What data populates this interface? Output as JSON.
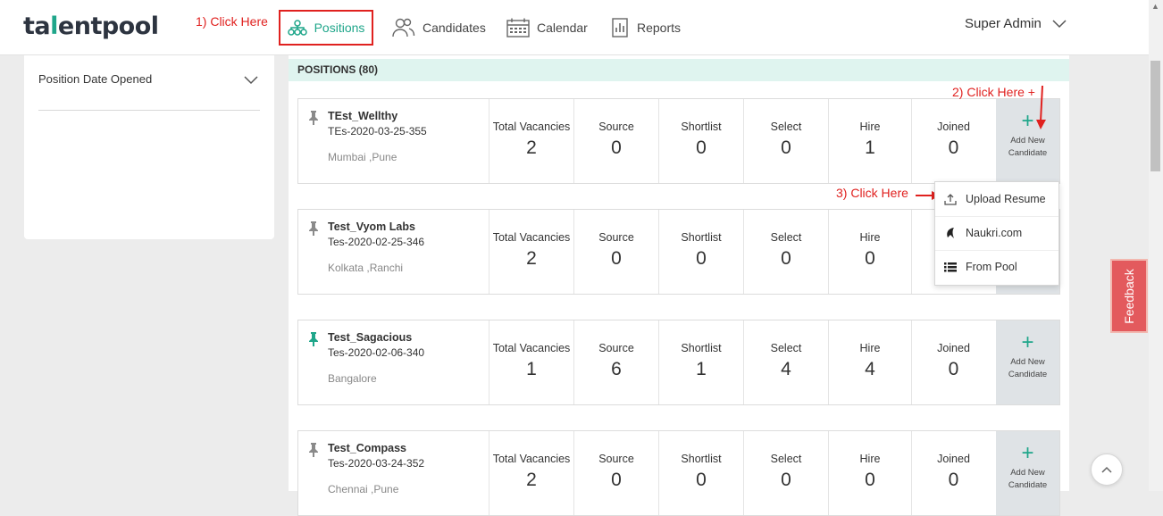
{
  "app": {
    "logo_pre": "ta",
    "logo_dot": "l",
    "logo_post": "entpool"
  },
  "annotations": {
    "step1": "1) Click Here",
    "step2": "2) Click Here +",
    "step3": "3) Click Here"
  },
  "nav": {
    "positions": "Positions",
    "candidates": "Candidates",
    "calendar": "Calendar",
    "reports": "Reports"
  },
  "user": {
    "name": "Super Admin"
  },
  "filter": {
    "title": "Position Date Opened"
  },
  "positions_header": "POSITIONS (80)",
  "stat_labels": [
    "Total Vacancies",
    "Source",
    "Shortlist",
    "Select",
    "Hire",
    "Joined"
  ],
  "add_candidate": {
    "line1": "Add New",
    "line2": "Candidate"
  },
  "positions": [
    {
      "title": "TEst_Wellthy",
      "code": "TEs-2020-03-25-355",
      "location": "Mumbai ,Pune",
      "pinned": false,
      "values": [
        "2",
        "0",
        "0",
        "0",
        "1",
        "0"
      ]
    },
    {
      "title": "Test_Vyom Labs",
      "code": "Tes-2020-02-25-346",
      "location": "Kolkata ,Ranchi",
      "pinned": false,
      "values": [
        "2",
        "0",
        "0",
        "0",
        "0"
      ]
    },
    {
      "title": "Test_Sagacious",
      "code": "Tes-2020-02-06-340",
      "location": "Bangalore",
      "pinned": true,
      "values": [
        "1",
        "6",
        "1",
        "4",
        "4",
        "0"
      ]
    },
    {
      "title": "Test_Compass",
      "code": "Tes-2020-03-24-352",
      "location": "Chennai ,Pune",
      "pinned": false,
      "values": [
        "2",
        "0",
        "0",
        "0",
        "0",
        "0"
      ]
    }
  ],
  "dropdown": {
    "upload": "Upload Resume",
    "naukri": "Naukri.com",
    "pool": "From Pool"
  },
  "feedback": "Feedback",
  "colors": {
    "brand": "#1fa68a",
    "annotation": "#e0211f",
    "feedback": "#e35a5d"
  }
}
